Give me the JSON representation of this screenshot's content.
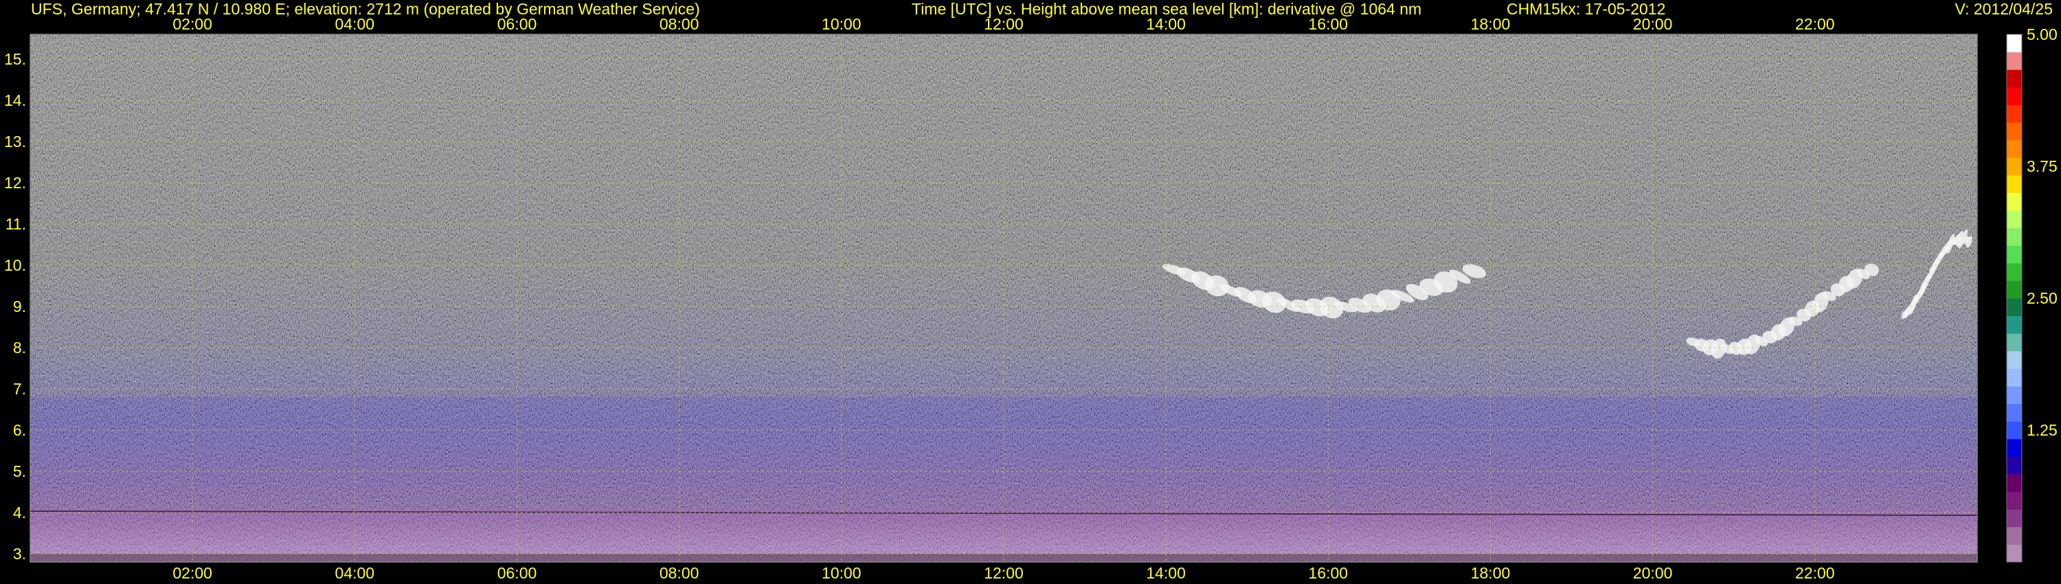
{
  "header": {
    "site": "UFS, Germany; 47.417 N / 10.980 E; elevation: 2712 m  (operated by German Weather Service)",
    "axes_desc": "Time [UTC] vs. Height above mean sea level [km]: derivative @ 1064 nm",
    "instrument": "CHM15kx: 17-05-2012",
    "version": "V: 2012/04/25"
  },
  "colors": {
    "text": "#ffff33",
    "grid": "#c8c832",
    "background": "#000000"
  },
  "chart_data": {
    "type": "heatmap",
    "title": "",
    "xlabel": "Time [UTC]",
    "ylabel": "Height above mean sea level [km]",
    "xlim": [
      "00:00",
      "24:00"
    ],
    "ylim": [
      2.8,
      15.6
    ],
    "x_ticks": [
      "02:00",
      "04:00",
      "06:00",
      "08:00",
      "10:00",
      "12:00",
      "14:00",
      "16:00",
      "18:00",
      "20:00",
      "22:00"
    ],
    "x_tick_hours": [
      2,
      4,
      6,
      8,
      10,
      12,
      14,
      16,
      18,
      20,
      22
    ],
    "y_ticks": [
      "3.",
      "4.",
      "5.",
      "6.",
      "7.",
      "8.",
      "9.",
      "10.",
      "11.",
      "12.",
      "13.",
      "14.",
      "15."
    ],
    "y_tick_values": [
      3,
      4,
      5,
      6,
      7,
      8,
      9,
      10,
      11,
      12,
      13,
      14,
      15
    ],
    "grid": true,
    "colorbar": {
      "min": 0,
      "max": 5,
      "tick_labels": [
        "5.00",
        "3.75",
        "2.50",
        "1.25"
      ],
      "tick_values": [
        5.0,
        3.75,
        2.5,
        1.25
      ],
      "colors": [
        "#b58fb5",
        "#a070a0",
        "#8a3a8a",
        "#7a1a7a",
        "#6a006a",
        "#2200aa",
        "#0000dd",
        "#3355ff",
        "#5577ff",
        "#7799ff",
        "#99bbff",
        "#aaccee",
        "#66bbaa",
        "#229988",
        "#117744",
        "#229922",
        "#33bb33",
        "#55dd55",
        "#88ee66",
        "#bbff66",
        "#eeff44",
        "#ffdd00",
        "#ffaa00",
        "#ff8800",
        "#ff6600",
        "#ff3300",
        "#ff0000",
        "#cc0000",
        "#ee8888",
        "#ffffff"
      ],
      "placement": "right"
    },
    "features": [
      {
        "name": "cloud layer",
        "time_start": 14.1,
        "time_end": 17.8,
        "height_bottom": 8.3,
        "height_top": 10.4
      },
      {
        "name": "cloud layer",
        "time_start": 20.5,
        "time_end": 22.7,
        "height_bottom": 7.2,
        "height_top": 9.6
      },
      {
        "name": "cloud layer",
        "time_start": 23.1,
        "time_end": 23.9,
        "height_bottom": 8.0,
        "height_top": 10.2
      },
      {
        "name": "boundary layer top",
        "time_start": 0,
        "time_end": 24,
        "height_bottom": 2.8,
        "height_top": 4.1
      },
      {
        "name": "aerosol layer",
        "time_start": 0,
        "time_end": 24,
        "height_bottom": 3.0,
        "height_top": 6.8
      }
    ]
  }
}
